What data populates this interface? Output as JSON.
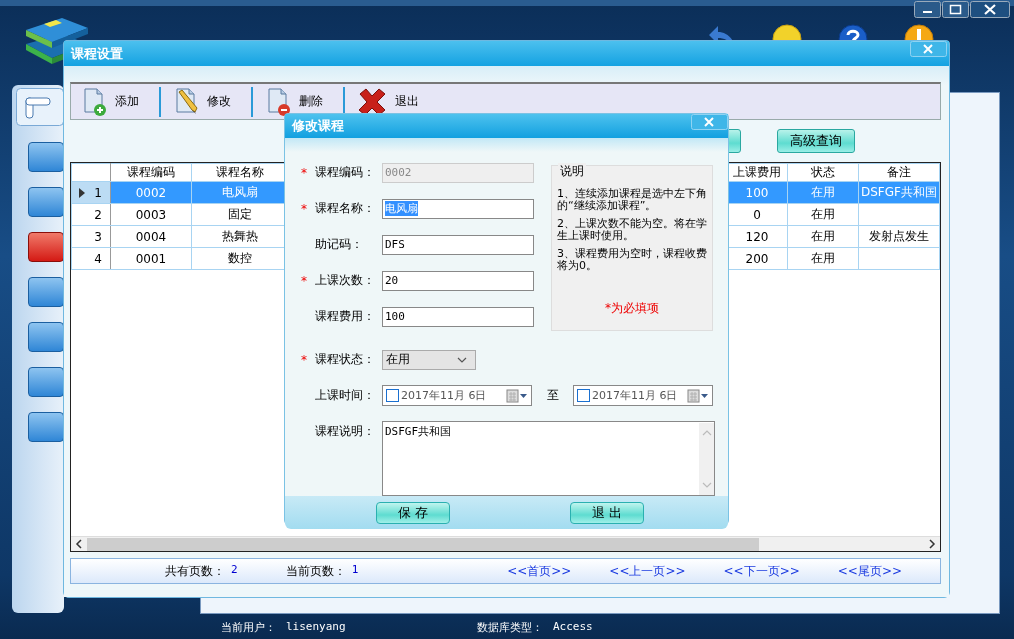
{
  "sidebar": {
    "items": [
      {
        "selected": false
      },
      {
        "selected": false
      },
      {
        "selected": true
      },
      {
        "selected": false
      },
      {
        "selected": false
      },
      {
        "selected": false
      },
      {
        "selected": false
      }
    ]
  },
  "course_window": {
    "title": "课程设置",
    "toolbar": [
      {
        "kind": "add",
        "label": "添加"
      },
      {
        "kind": "edit",
        "label": "修改"
      },
      {
        "kind": "delete",
        "label": "删除"
      },
      {
        "kind": "exit",
        "label": "退出"
      }
    ],
    "search_button": "高级查询",
    "table": {
      "columns": [
        "课程编码",
        "课程名称",
        "上课费用",
        "状态",
        "备注"
      ],
      "rows": [
        {
          "number": "1",
          "selected": true,
          "cells": [
            "0002",
            "电风扇",
            "100",
            "在用",
            "DSFGF共和国"
          ]
        },
        {
          "number": "2",
          "selected": false,
          "cells": [
            "0003",
            "固定",
            "0",
            "在用",
            ""
          ]
        },
        {
          "number": "3",
          "selected": false,
          "cells": [
            "0004",
            "热舞热",
            "120",
            "在用",
            "发射点发生"
          ]
        },
        {
          "number": "4",
          "selected": false,
          "cells": [
            "0001",
            "数控",
            "200",
            "在用",
            ""
          ]
        }
      ]
    },
    "pager": {
      "stats": [
        {
          "label": "共有页数：",
          "value": "2"
        },
        {
          "label": "当前页数：",
          "value": "1"
        }
      ],
      "links": [
        "<<首页>>",
        "<<上一页>>",
        "<<下一页>>",
        "<<尾页>>"
      ]
    }
  },
  "dialog": {
    "title": "修改课程",
    "fields": [
      {
        "kind": "text",
        "required_mark": "*",
        "label": "课程编码：",
        "value": "0002",
        "disabled": true
      },
      {
        "kind": "text",
        "required_mark": "*",
        "label": "课程名称：",
        "value": "电风扇",
        "text_selected": true
      },
      {
        "kind": "text",
        "label": "助记码：",
        "value": "DFS"
      },
      {
        "kind": "text",
        "required_mark": "*",
        "label": "上课次数：",
        "value": "20"
      },
      {
        "kind": "text",
        "label": "课程费用：",
        "value": "100"
      },
      {
        "kind": "select",
        "required_mark": "*",
        "label": "课程状态：",
        "value": "在用"
      },
      {
        "kind": "daterange",
        "label": "上课时间：",
        "from": {
          "value": "2017年11月 6日",
          "checked": false
        },
        "separator": "至",
        "to": {
          "value": "2017年11月 6日",
          "checked": false
        }
      },
      {
        "kind": "textarea",
        "label": "课程说明：",
        "value": "DSFGF共和国"
      }
    ],
    "notes": {
      "legend": "说明",
      "items": [
        "1、连续添加课程是选中左下角的“继续添加课程”。",
        "2、上课次数不能为空。将在学生上课时使用。",
        "3、课程费用为空时，课程收费将为0。"
      ],
      "footer": "*为必填项"
    },
    "buttons": [
      "保 存",
      "退 出"
    ]
  },
  "status_bar": [
    {
      "label": "当前用户：",
      "value": "lisenyang"
    },
    {
      "label": "数据库类型：",
      "value": "Access"
    }
  ]
}
